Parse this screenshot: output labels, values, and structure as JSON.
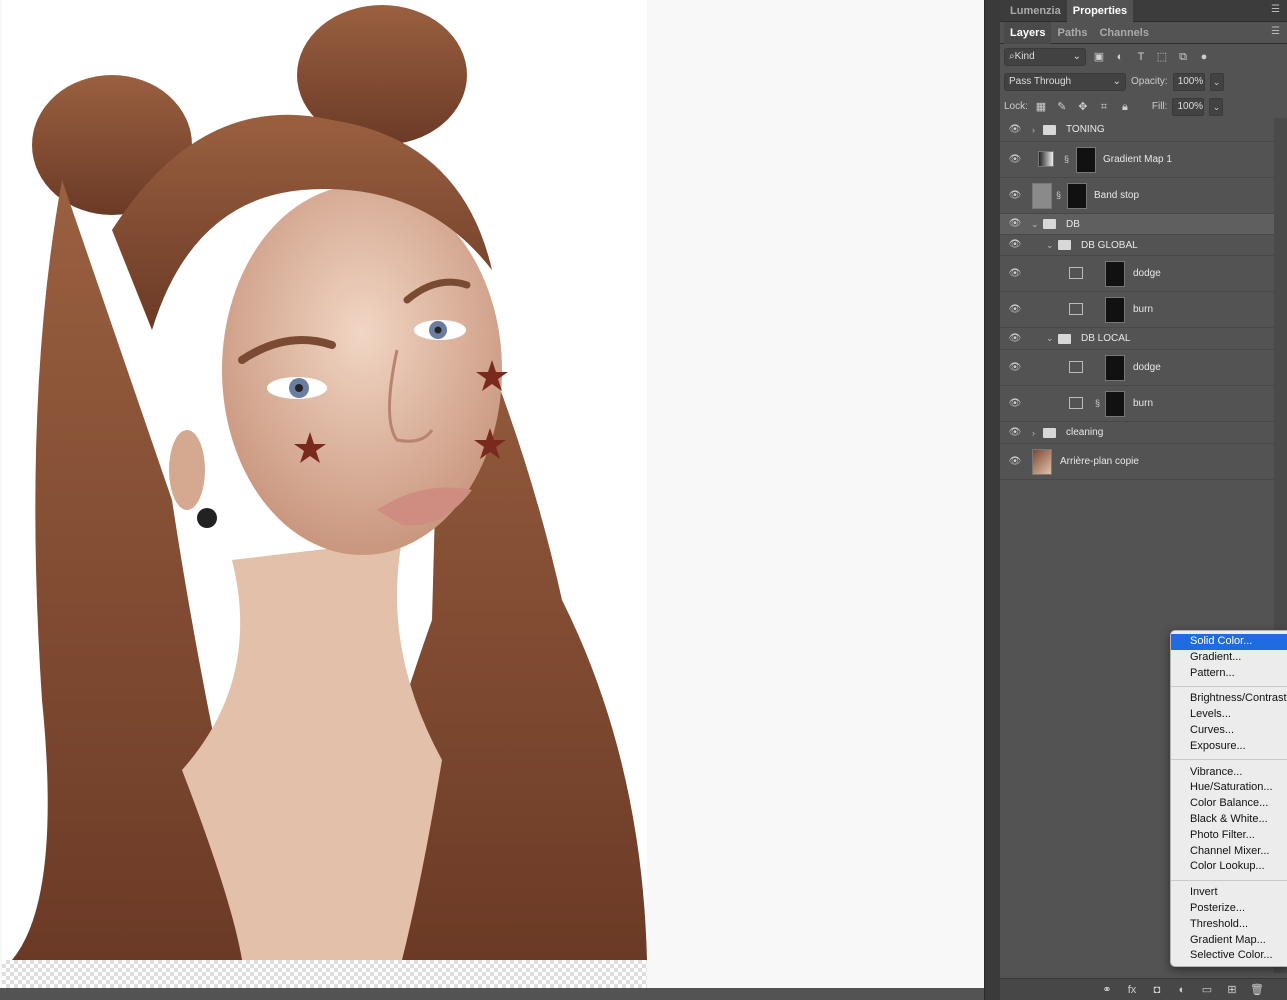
{
  "panel_tabs_top": [
    "Lumenzia",
    "Properties"
  ],
  "panel_tabs": [
    "Layers",
    "Paths",
    "Channels"
  ],
  "filter": {
    "kind_label": "Kind"
  },
  "blend": {
    "mode": "Pass Through",
    "opacity_label": "Opacity:",
    "opacity": "100%"
  },
  "lock": {
    "label": "Lock:",
    "fill_label": "Fill:",
    "fill": "100%"
  },
  "layers": [
    {
      "name": "TONING",
      "type": "group",
      "expanded": false
    },
    {
      "name": "Gradient Map 1",
      "type": "adjustment"
    },
    {
      "name": "Band stop",
      "type": "layer"
    },
    {
      "name": "DB",
      "type": "group",
      "expanded": true,
      "selected": true
    },
    {
      "name": "DB GLOBAL",
      "type": "group",
      "expanded": true
    },
    {
      "name": "dodge",
      "type": "curves"
    },
    {
      "name": "burn",
      "type": "curves"
    },
    {
      "name": "DB LOCAL",
      "type": "group",
      "expanded": true
    },
    {
      "name": "dodge",
      "type": "curves"
    },
    {
      "name": "burn",
      "type": "curves"
    },
    {
      "name": "cleaning",
      "type": "group",
      "expanded": false
    },
    {
      "name": "Arrière-plan copie",
      "type": "pixel"
    }
  ],
  "menu": {
    "groups": [
      [
        "Solid Color...",
        "Gradient...",
        "Pattern..."
      ],
      [
        "Brightness/Contrast...",
        "Levels...",
        "Curves...",
        "Exposure..."
      ],
      [
        "Vibrance...",
        "Hue/Saturation...",
        "Color Balance...",
        "Black & White...",
        "Photo Filter...",
        "Channel Mixer...",
        "Color Lookup..."
      ],
      [
        "Invert",
        "Posterize...",
        "Threshold...",
        "Gradient Map...",
        "Selective Color..."
      ]
    ],
    "selected": "Solid Color..."
  },
  "bottom_icons": [
    "link-icon",
    "fx-icon",
    "mask-icon",
    "adjustment-icon",
    "new-group-icon",
    "new-layer-icon",
    "trash-icon"
  ],
  "colors": {
    "panel_bg": "#535353",
    "highlight": "#1f6ce0",
    "hair": "#7a4a32"
  }
}
